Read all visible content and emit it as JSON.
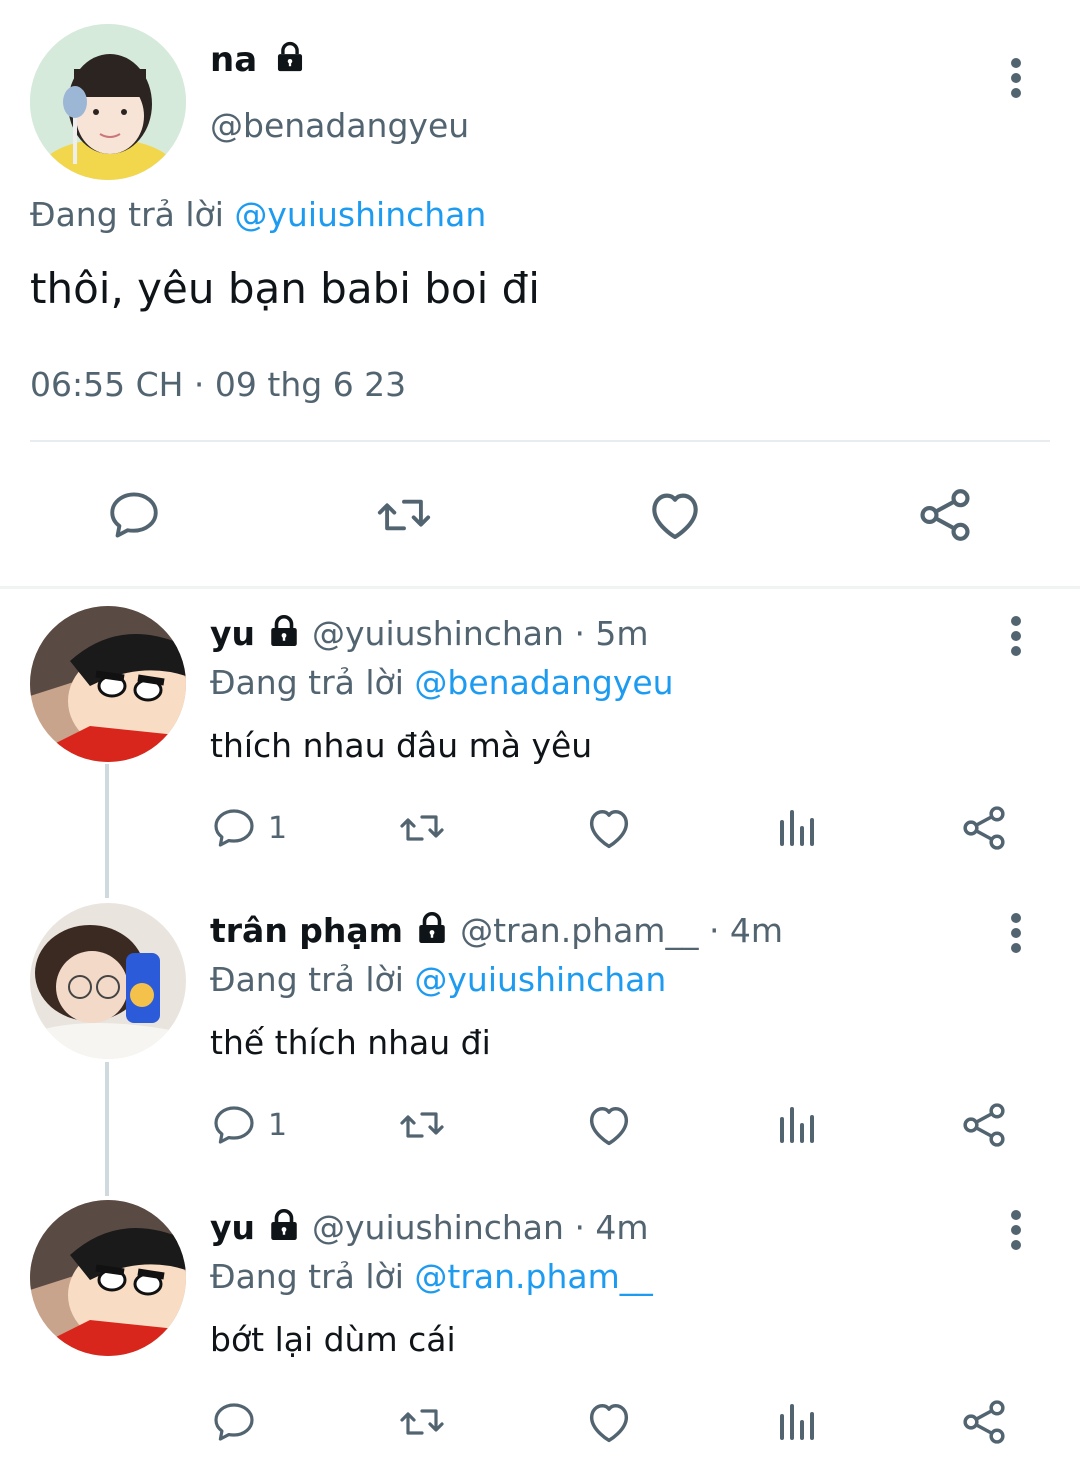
{
  "main_tweet": {
    "name": "na",
    "handle": "@benadangyeu",
    "reply_prefix": "Đang trả lời",
    "reply_to": "@yuiushinchan",
    "text": "thôi, yêu bạn babi boi đi",
    "timestamp": "06:55 CH · 09 thg 6 23"
  },
  "replies": [
    {
      "name": "yu",
      "handle": "@yuiushinchan",
      "time": "· 5m",
      "reply_prefix": "Đang trả lời",
      "reply_to": "@benadangyeu",
      "text": "thích nhau đâu mà yêu",
      "reply_count": "1"
    },
    {
      "name": "trân phạm",
      "handle": "@tran.pham__",
      "time": "· 4m",
      "reply_prefix": "Đang trả lời",
      "reply_to": "@yuiushinchan",
      "text": "thế thích nhau đi",
      "reply_count": "1"
    },
    {
      "name": "yu",
      "handle": "@yuiushinchan",
      "time": "· 4m",
      "reply_prefix": "Đang trả lời",
      "reply_to": "@tran.pham__",
      "text": "bớt lại dùm cái",
      "reply_count": ""
    }
  ],
  "icons": {
    "reply": "speech-bubble-icon",
    "retweet": "retweet-icon",
    "like": "heart-icon",
    "views": "bar-chart-icon",
    "share": "share-icon",
    "more": "vertical-dots-icon",
    "protected": "lock-icon"
  },
  "colors": {
    "accent": "#1d9bf0",
    "secondary_text": "#536471",
    "primary_text": "#0f1419"
  }
}
